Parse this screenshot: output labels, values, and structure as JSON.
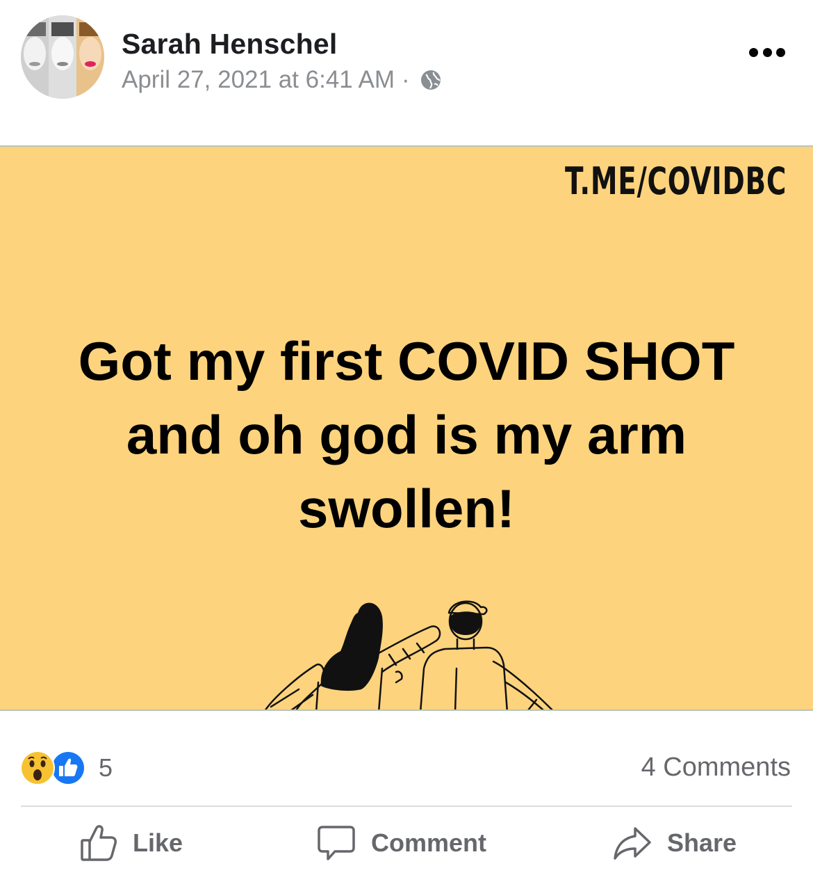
{
  "post": {
    "author": "Sarah Henschel",
    "timestamp": "April 27, 2021 at 6:41 AM",
    "separator": "·",
    "privacy_icon": "globe-icon",
    "more_icon": "more-options-icon"
  },
  "image": {
    "watermark": "T.ME/COVIDBC",
    "headline": "Got my first COVID SHOT and oh god is my arm swollen!",
    "background": "#fdd37d"
  },
  "stats": {
    "reaction_icons": [
      "wow-reaction-icon",
      "like-reaction-icon"
    ],
    "reaction_count": "5",
    "comments": "4 Comments"
  },
  "actions": {
    "like_label": "Like",
    "comment_label": "Comment",
    "share_label": "Share"
  },
  "colors": {
    "like_blue": "#1877f2",
    "muted_text": "#65676b",
    "meta_text": "#8a8d91"
  }
}
